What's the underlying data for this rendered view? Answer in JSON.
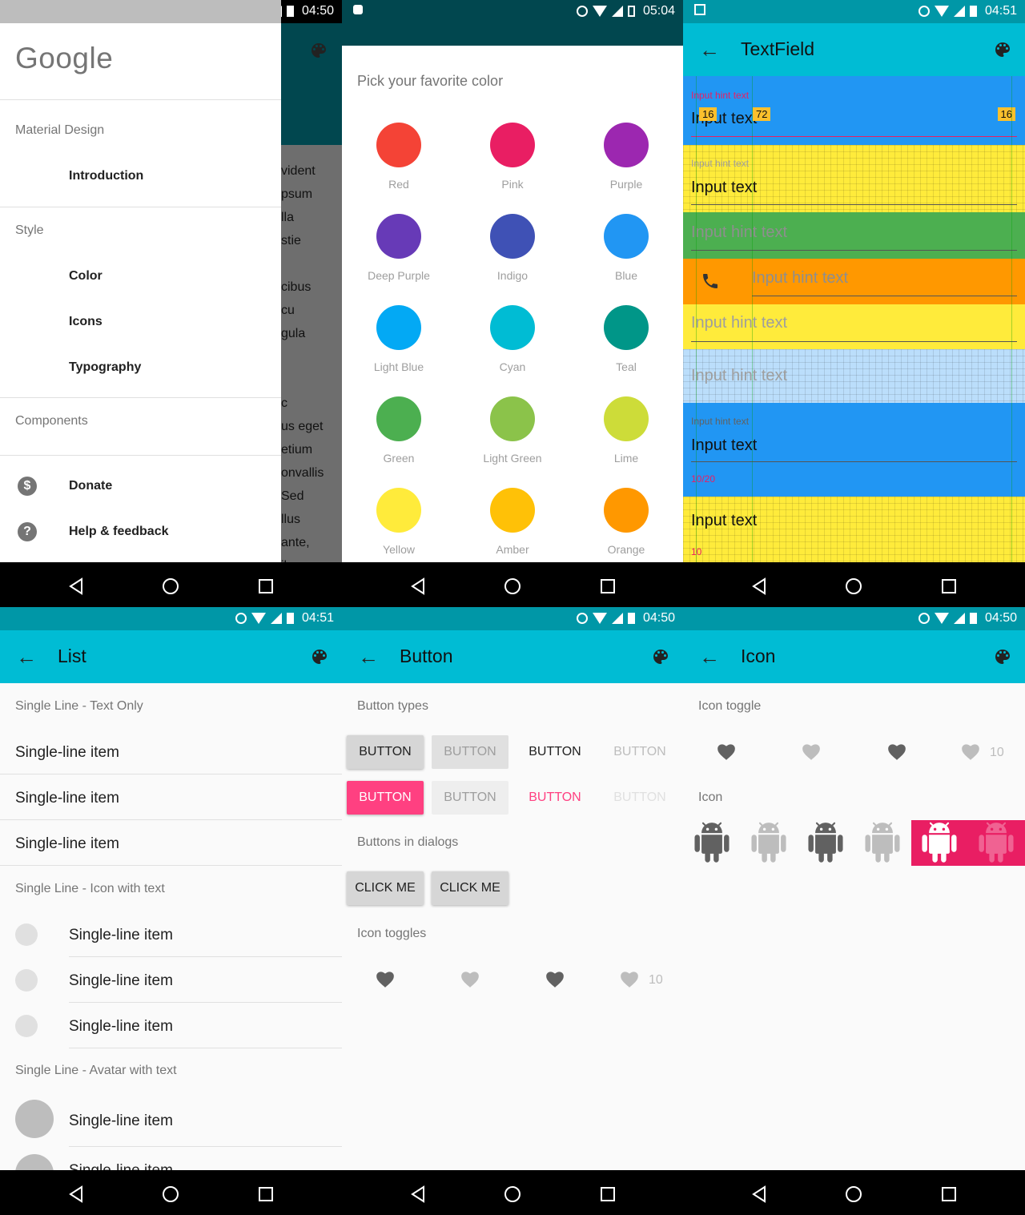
{
  "screens": {
    "drawer": {
      "status_time": "04:50",
      "logo": "Google",
      "sections": [
        {
          "label": "Material Design",
          "items": [
            "Introduction"
          ]
        },
        {
          "label": "Style",
          "items": [
            "Color",
            "Icons",
            "Typography"
          ]
        },
        {
          "label": "Components",
          "items": []
        }
      ],
      "footer_items": [
        {
          "icon": "donate-icon",
          "label": "Donate"
        },
        {
          "icon": "help-icon",
          "label": "Help & feedback"
        }
      ],
      "behind_text": [
        "vident",
        "psum",
        "lla",
        "stie",
        "",
        "cibus",
        "cu",
        "gula",
        "",
        "",
        "c",
        "us eget",
        "etium",
        "onvallis",
        "Sed",
        "llus",
        "ante,",
        "ibus"
      ]
    },
    "color_picker": {
      "status_time": "05:04",
      "title": "Pick your favorite color",
      "colors": [
        {
          "name": "Red",
          "hex": "#f44336"
        },
        {
          "name": "Pink",
          "hex": "#e91e63"
        },
        {
          "name": "Purple",
          "hex": "#9c27b0"
        },
        {
          "name": "Deep Purple",
          "hex": "#673ab7"
        },
        {
          "name": "Indigo",
          "hex": "#3f51b5"
        },
        {
          "name": "Blue",
          "hex": "#2196f3"
        },
        {
          "name": "Light Blue",
          "hex": "#03a9f4"
        },
        {
          "name": "Cyan",
          "hex": "#00bcd4"
        },
        {
          "name": "Teal",
          "hex": "#009688"
        },
        {
          "name": "Green",
          "hex": "#4caf50"
        },
        {
          "name": "Light Green",
          "hex": "#8bc34a"
        },
        {
          "name": "Lime",
          "hex": "#cddc39"
        },
        {
          "name": "Yellow",
          "hex": "#ffeb3b"
        },
        {
          "name": "Amber",
          "hex": "#ffc107"
        },
        {
          "name": "Orange",
          "hex": "#ff9800"
        }
      ]
    },
    "textfield": {
      "status_time": "04:51",
      "title": "TextField",
      "hint": "Input hint text",
      "value": "Input text",
      "badges": [
        "16",
        "72",
        "16"
      ],
      "counter_full": "10/20",
      "counter_short": "10"
    },
    "list": {
      "status_time": "04:51",
      "title": "List",
      "sub1": "Single Line - Text Only",
      "sub2": "Single Line - Icon with text",
      "sub3": "Single Line - Avatar with text",
      "item": "Single-line item"
    },
    "button": {
      "status_time": "04:50",
      "title": "Button",
      "sub_types": "Button types",
      "sub_dialogs": "Buttons in dialogs",
      "sub_toggles": "Icon toggles",
      "btn_label": "BUTTON",
      "click_label": "CLICK ME",
      "toggle_count": "10"
    },
    "icon": {
      "status_time": "04:50",
      "title": "Icon",
      "sub_toggle": "Icon toggle",
      "sub_icon": "Icon",
      "toggle_count": "10"
    }
  },
  "colors": {
    "primary": "#00bcd4",
    "accent": "#ff4081",
    "status_bar": "#0097a7"
  }
}
